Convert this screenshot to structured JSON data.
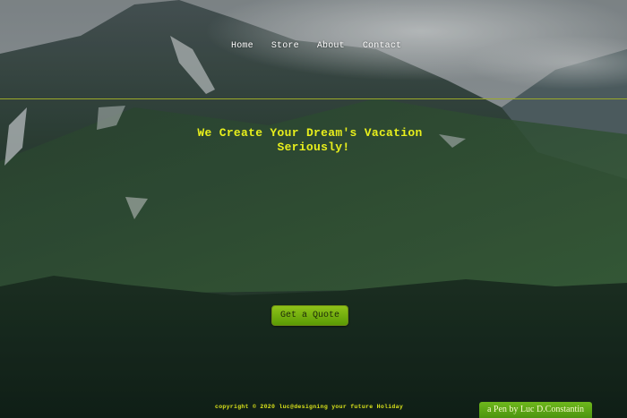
{
  "nav": {
    "items": [
      {
        "label": "Home"
      },
      {
        "label": "Store"
      },
      {
        "label": "About"
      },
      {
        "label": "Contact"
      }
    ]
  },
  "hero": {
    "headline": "We Create Your Dream's Vacation",
    "subheadline": "Seriously!",
    "cta_label": "Get a Quote"
  },
  "footer": {
    "copyright": "copyright © 2020 luc@designing your future Holiday"
  },
  "badge": {
    "label": "a Pen by Luc D.Constantin"
  },
  "colors": {
    "accent_text": "#e8ef1c",
    "button": "#7bb516",
    "divider": "#9aa92a"
  }
}
